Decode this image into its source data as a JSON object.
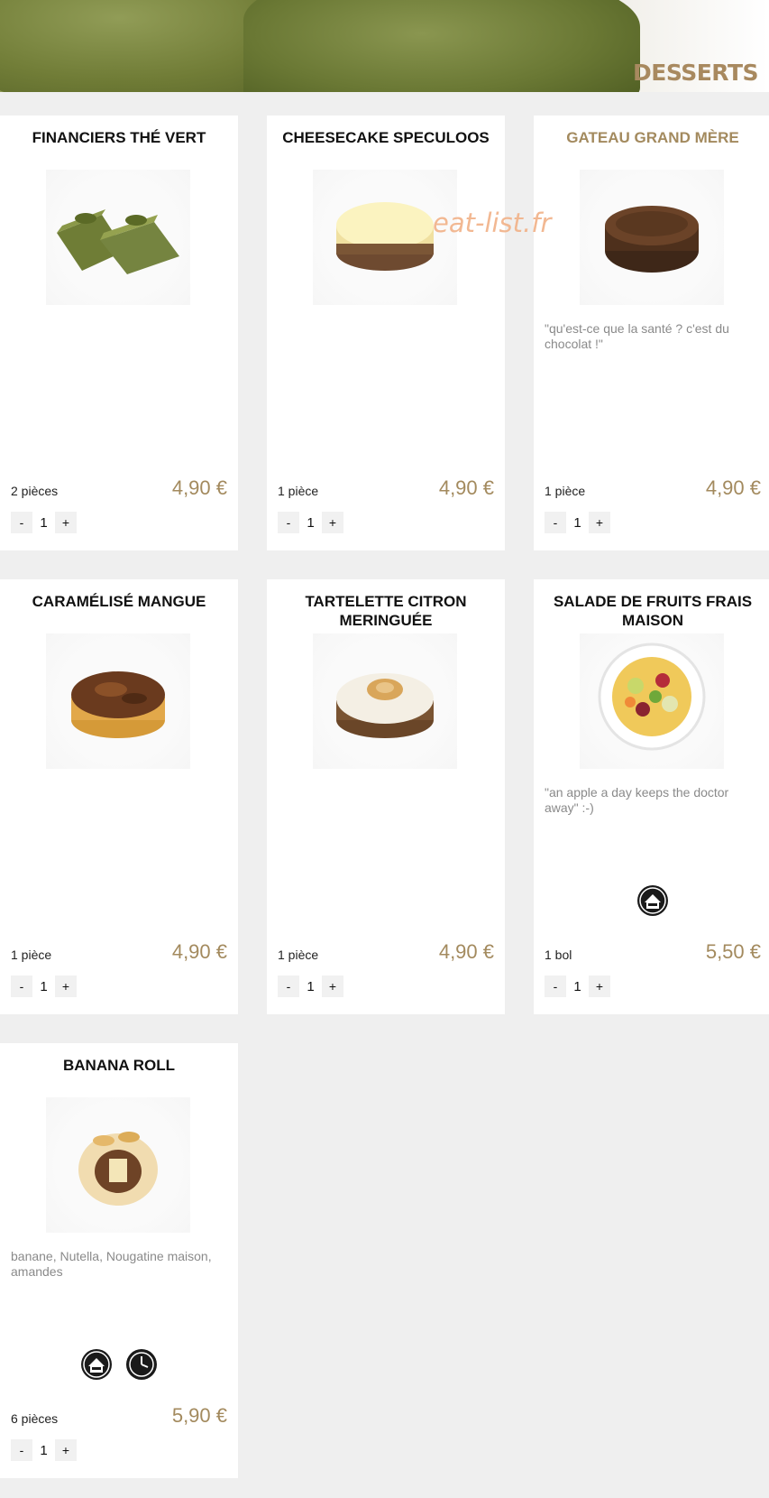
{
  "banner": {
    "title": "DESSERTS"
  },
  "watermark": "eat-list.fr",
  "products": [
    {
      "name": "FINANCIERS THÉ VERT",
      "description": "",
      "quantity_label": "2 pièces",
      "price": "4,90 €",
      "count": "1",
      "minus": "-",
      "plus": "+",
      "photo": "green-tea-financiers"
    },
    {
      "name": "CHEESECAKE SPECULOOS",
      "description": "",
      "quantity_label": "1 pièce",
      "price": "4,90 €",
      "count": "1",
      "minus": "-",
      "plus": "+",
      "photo": "speculoos-cheesecake"
    },
    {
      "name": "GATEAU GRAND MÈRE",
      "description": "\"qu'est-ce que la santé ? c'est du chocolat !\"",
      "quantity_label": "1 pièce",
      "price": "4,90 €",
      "count": "1",
      "minus": "-",
      "plus": "+",
      "photo": "chocolate-cake"
    },
    {
      "name": "CARAMÉLISÉ MANGUE",
      "description": "",
      "quantity_label": "1 pièce",
      "price": "4,90 €",
      "count": "1",
      "minus": "-",
      "plus": "+",
      "photo": "mango-caramelise"
    },
    {
      "name": "TARTELETTE CITRON MERINGUÉE",
      "description": "",
      "quantity_label": "1 pièce",
      "price": "4,90 €",
      "count": "1",
      "minus": "-",
      "plus": "+",
      "photo": "lemon-meringue-tart"
    },
    {
      "name": "SALADE DE FRUITS FRAIS MAISON",
      "description": "\"an apple a day keeps the doctor away\" :-)",
      "quantity_label": "1 bol",
      "price": "5,50 €",
      "count": "1",
      "minus": "-",
      "plus": "+",
      "photo": "fruit-salad-bowl"
    },
    {
      "name": "BANANA ROLL",
      "description": "banane, Nutella, Nougatine maison, amandes",
      "quantity_label": "6 pièces",
      "price": "5,90 €",
      "count": "1",
      "minus": "-",
      "plus": "+",
      "photo": "banana-roll"
    }
  ],
  "badges": {
    "house_icon": "fait-maison-badge-icon",
    "clock_icon": "clock-badge-icon"
  },
  "colors": {
    "accent": "#a38a5e",
    "background": "#efefef",
    "card": "#ffffff",
    "watermark": "#f2b58d"
  }
}
